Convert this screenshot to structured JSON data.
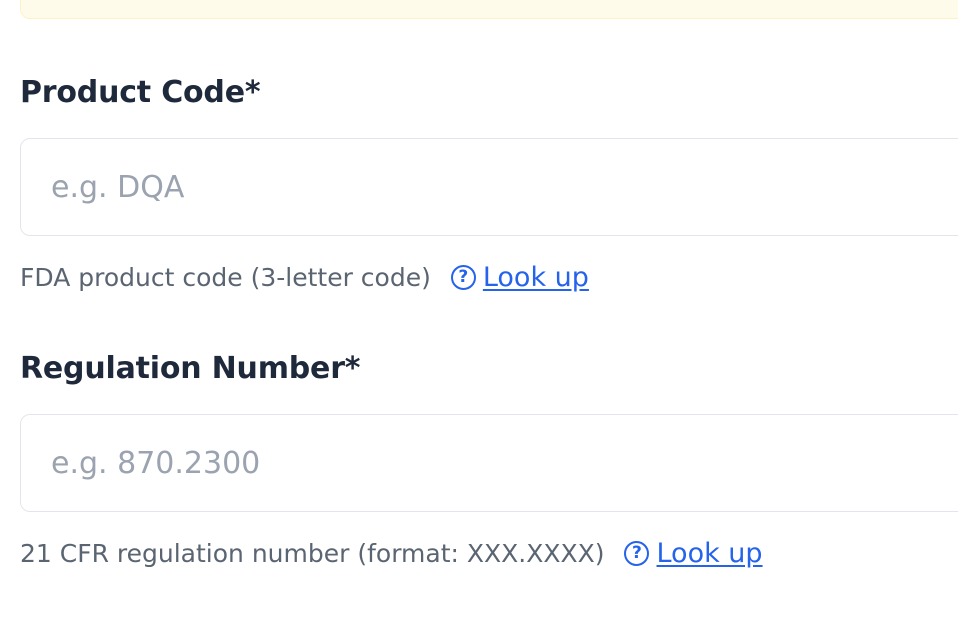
{
  "fields": [
    {
      "label": "Product Code*",
      "placeholder": "e.g. DQA",
      "value": "",
      "help_text": "FDA product code (3-letter code)",
      "help_icon": "question-circle-icon",
      "link_label": "Look up"
    },
    {
      "label": "Regulation Number*",
      "placeholder": "e.g. 870.2300",
      "value": "",
      "help_text": "21 CFR regulation number (format: XXX.XXXX)",
      "help_icon": "question-circle-icon",
      "link_label": "Look up"
    }
  ],
  "colors": {
    "label": "#1e293b",
    "placeholder": "#9aa3af",
    "help_text": "#5b6572",
    "link": "#2563eb",
    "input_border": "#e2e6ec",
    "banner_background": "#fffbeb"
  }
}
